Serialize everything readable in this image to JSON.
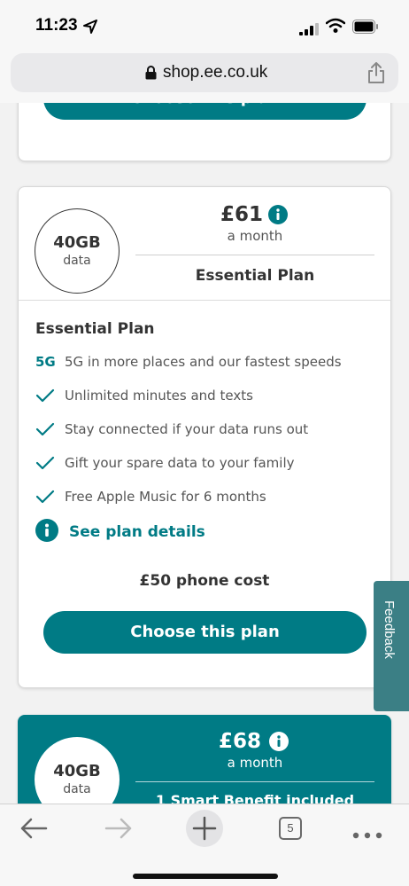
{
  "status_bar": {
    "time": "11:23"
  },
  "browser": {
    "url": "shop.ee.co.uk"
  },
  "top_card": {
    "button_label": "Choose this plan"
  },
  "plan": {
    "data_amount": "40GB",
    "data_unit": "data",
    "price": "£61",
    "period": "a month",
    "name": "Essential Plan",
    "section_title": "Essential Plan",
    "features": [
      {
        "badge": "5G",
        "text": "5G in more places and our fastest speeds",
        "icon": "5g-badge"
      },
      {
        "text": "Unlimited minutes and texts",
        "icon": "check-icon"
      },
      {
        "text": "Stay connected if your data runs out",
        "icon": "check-icon"
      },
      {
        "text": "Gift your spare data to your family",
        "icon": "check-icon"
      },
      {
        "text": "Free Apple Music for 6 months",
        "icon": "check-icon"
      }
    ],
    "details_link": "See plan details",
    "phone_cost": "£50 phone cost",
    "button_label": "Choose this plan"
  },
  "next_plan": {
    "data_amount": "40GB",
    "data_unit": "data",
    "price": "£68",
    "period": "a month",
    "benefit": "1 Smart Benefit included"
  },
  "feedback": {
    "label": "Feedback"
  },
  "toolbar": {
    "tab_count": "5"
  },
  "colors": {
    "brand": "#007b85",
    "feedback_bg": "#3b7f85"
  }
}
